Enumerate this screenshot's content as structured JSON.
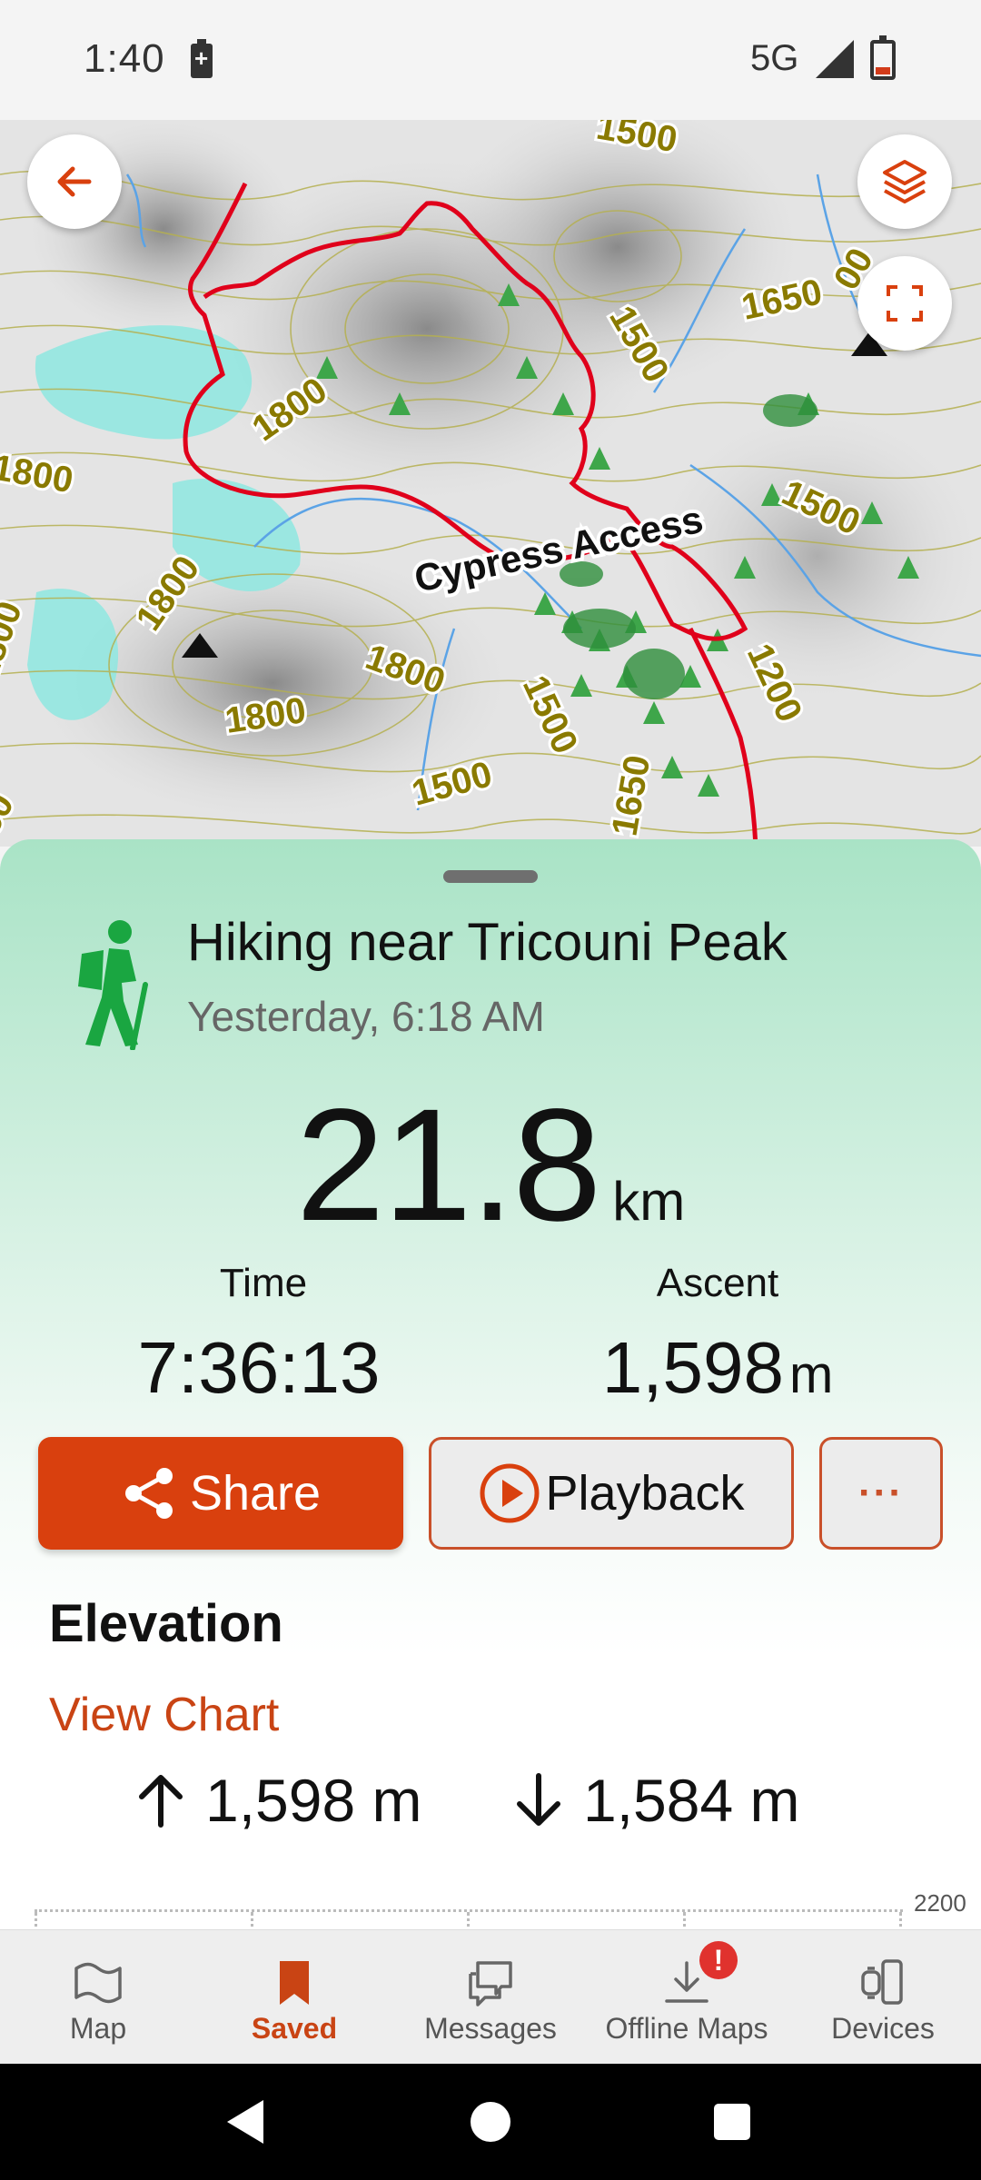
{
  "status_bar": {
    "time": "1:40",
    "network": "5G"
  },
  "map": {
    "road_label": "Cypress Access",
    "contour_labels": [
      "1500",
      "1500",
      "1650",
      "1500",
      "1800",
      "1800",
      "1800",
      "1500",
      "1200",
      "1800",
      "1800",
      "1800",
      "1500",
      "1650",
      "50",
      "00",
      "165"
    ]
  },
  "activity": {
    "title": "Hiking near Tricouni Peak",
    "date": "Yesterday, 6:18 AM",
    "distance_value": "21.8",
    "distance_unit": "km",
    "time_label": "Time",
    "time_value": "7:36:13",
    "ascent_label": "Ascent",
    "ascent_value": "1,598",
    "ascent_unit": "m"
  },
  "actions": {
    "share_label": "Share",
    "playback_label": "Playback",
    "more_label": "···"
  },
  "elevation": {
    "title": "Elevation",
    "view_chart_label": "View Chart",
    "gain": "1,598 m",
    "loss": "1,584 m",
    "chart_max_label": "2200"
  },
  "bottom_nav": {
    "items": [
      {
        "label": "Map"
      },
      {
        "label": "Saved"
      },
      {
        "label": "Messages"
      },
      {
        "label": "Offline Maps"
      },
      {
        "label": "Devices"
      }
    ],
    "badge": "!"
  },
  "colors": {
    "accent": "#d9400e",
    "route": "#e0001b",
    "sheet_green": "#a9e3c6"
  }
}
